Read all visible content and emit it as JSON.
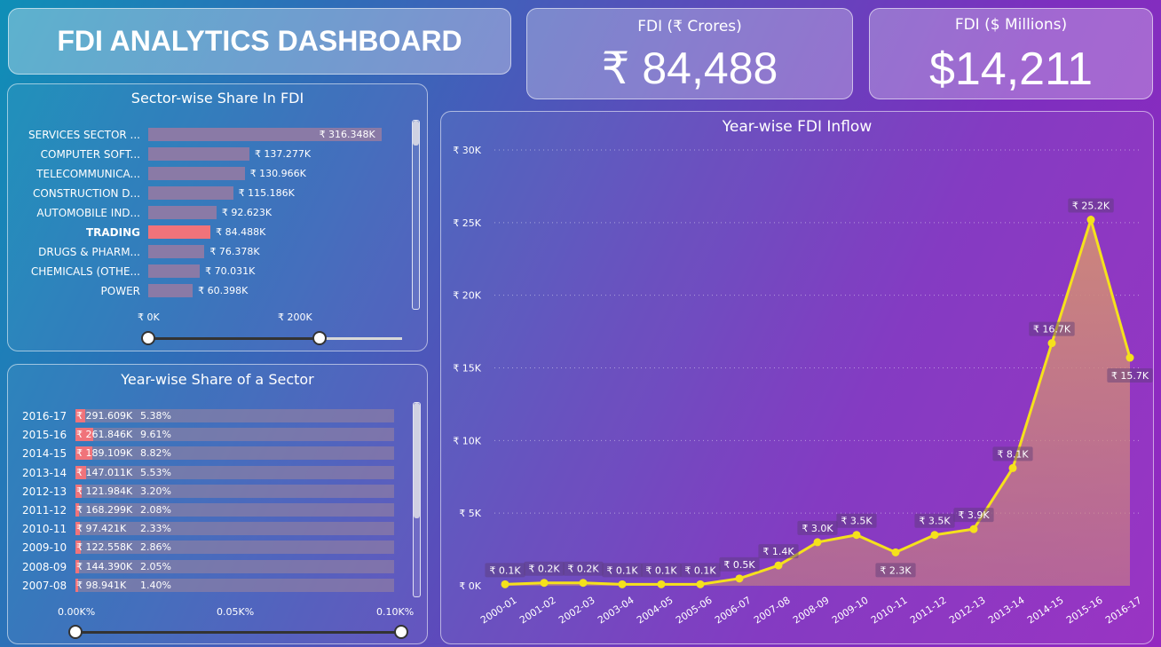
{
  "header": {
    "title": "FDI ANALYTICS DASHBOARD"
  },
  "kpis": [
    {
      "label": "FDI (₹ Crores)",
      "value": "₹ 84,488"
    },
    {
      "label": "FDI ($ Millions)",
      "value": "$14,211"
    }
  ],
  "sector_panel": {
    "title": "Sector-wise Share In FDI",
    "axis_labels": [
      "₹ 0K",
      "₹ 200K"
    ],
    "rows": [
      {
        "label": "SERVICES SECTOR ...",
        "value": 316.348,
        "text": "₹ 316.348K",
        "highlight": false
      },
      {
        "label": "COMPUTER SOFT...",
        "value": 137.277,
        "text": "₹ 137.277K",
        "highlight": false
      },
      {
        "label": "TELECOMMUNICA...",
        "value": 130.966,
        "text": "₹ 130.966K",
        "highlight": false
      },
      {
        "label": "CONSTRUCTION D...",
        "value": 115.186,
        "text": "₹ 115.186K",
        "highlight": false
      },
      {
        "label": "AUTOMOBILE IND...",
        "value": 92.623,
        "text": "₹ 92.623K",
        "highlight": false
      },
      {
        "label": "TRADING",
        "value": 84.488,
        "text": "₹ 84.488K",
        "highlight": true
      },
      {
        "label": "DRUGS & PHARM...",
        "value": 76.378,
        "text": "₹ 76.378K",
        "highlight": false
      },
      {
        "label": "CHEMICALS (OTHE...",
        "value": 70.031,
        "text": "₹ 70.031K",
        "highlight": false
      },
      {
        "label": "POWER",
        "value": 60.398,
        "text": "₹ 60.398K",
        "highlight": false
      }
    ],
    "slider_range": [
      0,
      0.74
    ]
  },
  "year_panel": {
    "title": "Year-wise Share of a Sector",
    "axis_labels": [
      "0.00K%",
      "0.05K%",
      "0.10K%"
    ],
    "rows": [
      {
        "year": "2016-17",
        "amount": "₹ 291.609K",
        "pct": "5.38%",
        "share": 5.38
      },
      {
        "year": "2015-16",
        "amount": "₹ 261.846K",
        "pct": "9.61%",
        "share": 9.61
      },
      {
        "year": "2014-15",
        "amount": "₹ 189.109K",
        "pct": "8.82%",
        "share": 8.82
      },
      {
        "year": "2013-14",
        "amount": "₹ 147.011K",
        "pct": "5.53%",
        "share": 5.53
      },
      {
        "year": "2012-13",
        "amount": "₹ 121.984K",
        "pct": "3.20%",
        "share": 3.2
      },
      {
        "year": "2011-12",
        "amount": "₹ 168.299K",
        "pct": "2.08%",
        "share": 2.08
      },
      {
        "year": "2010-11",
        "amount": "₹ 97.421K",
        "pct": "2.33%",
        "share": 2.33
      },
      {
        "year": "2009-10",
        "amount": "₹ 122.558K",
        "pct": "2.86%",
        "share": 2.86
      },
      {
        "year": "2008-09",
        "amount": "₹ 144.390K",
        "pct": "2.05%",
        "share": 2.05
      },
      {
        "year": "2007-08",
        "amount": "₹ 98.941K",
        "pct": "1.40%",
        "share": 1.4
      }
    ]
  },
  "chart_data": {
    "type": "area",
    "title": "Year-wise FDI Inflow",
    "categories": [
      "2000-01",
      "2001-02",
      "2002-03",
      "2003-04",
      "2004-05",
      "2005-06",
      "2006-07",
      "2007-08",
      "2008-09",
      "2009-10",
      "2010-11",
      "2011-12",
      "2012-13",
      "2013-14",
      "2014-15",
      "2015-16",
      "2016-17"
    ],
    "values": [
      0.1,
      0.2,
      0.2,
      0.1,
      0.1,
      0.1,
      0.5,
      1.4,
      3.0,
      3.5,
      2.3,
      3.5,
      3.9,
      8.1,
      16.7,
      25.2,
      15.7
    ],
    "data_labels": [
      "₹ 0.1K",
      "₹ 0.2K",
      "₹ 0.2K",
      "₹ 0.1K",
      "₹ 0.1K",
      "₹ 0.1K",
      "₹ 0.5K",
      "₹ 1.4K",
      "₹ 3.0K",
      "₹ 3.5K",
      "₹ 2.3K",
      "₹ 3.5K",
      "₹ 3.9K",
      "₹ 8.1K",
      "₹ 16.7K",
      "₹ 25.2K",
      "₹ 15.7K"
    ],
    "y_ticks": [
      "₹ 0K",
      "₹ 5K",
      "₹ 10K",
      "₹ 15K",
      "₹ 20K",
      "₹ 25K",
      "₹ 30K"
    ],
    "ylim": [
      0,
      30
    ],
    "grid": true,
    "colors": {
      "line": "#f5e11c",
      "area": "#d08a78"
    }
  },
  "colors": {
    "highlight": "#f0737a",
    "bar": "#8a7aa6"
  }
}
